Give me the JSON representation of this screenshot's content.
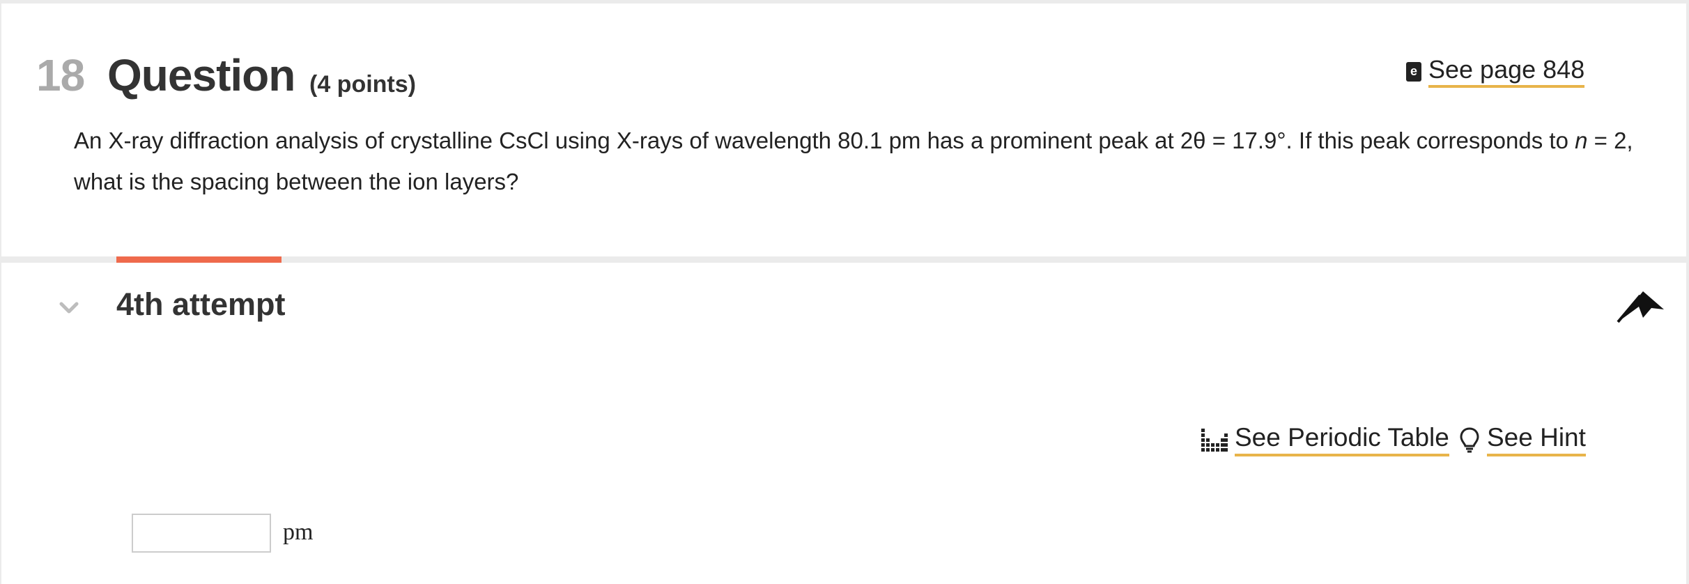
{
  "question": {
    "number": "18",
    "title": "Question",
    "points": "(4 points)",
    "ebook_link": "See page 848",
    "text_before_n": "An X-ray diffraction analysis of crystalline CsCl using X-rays of wavelength 80.1 pm has a prominent peak at 2θ = 17.9°. If this peak corresponds to ",
    "text_n": "n",
    "text_after_n": " = 2, what is the spacing between the ion layers?"
  },
  "attempt": {
    "label": "4th attempt"
  },
  "tools": {
    "periodic_table": "See Periodic Table",
    "hint": "See Hint"
  },
  "answer": {
    "value": "",
    "placeholder": "",
    "unit": "pm"
  },
  "colors": {
    "accent_tab": "#ef6a4c",
    "link_underline": "#e8b44a"
  },
  "icons": {
    "ebook": "ebook-icon",
    "chevron": "chevron-down-icon",
    "flag": "flag-icon",
    "periodic": "periodic-table-icon",
    "hint": "lightbulb-icon"
  }
}
